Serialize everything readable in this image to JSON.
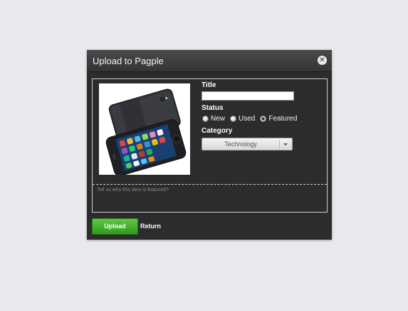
{
  "dialog": {
    "title": "Upload to Pagple",
    "close_glyph": "✕"
  },
  "form": {
    "title_label": "Title",
    "title_value": "",
    "status_label": "Status",
    "status_options": [
      {
        "label": "New",
        "checked": false
      },
      {
        "label": "Used",
        "checked": false
      },
      {
        "label": "Featured",
        "checked": true
      }
    ],
    "category_label": "Category",
    "category_value": "Technology",
    "reason_placeholder": "Tell us why this item is featured?"
  },
  "actions": {
    "upload_label": "Upload",
    "return_label": "Return"
  },
  "colors": {
    "background": "#e8e9ed",
    "dialog_bg": "#2c2c2c",
    "upload_green": "#3aa52a"
  }
}
